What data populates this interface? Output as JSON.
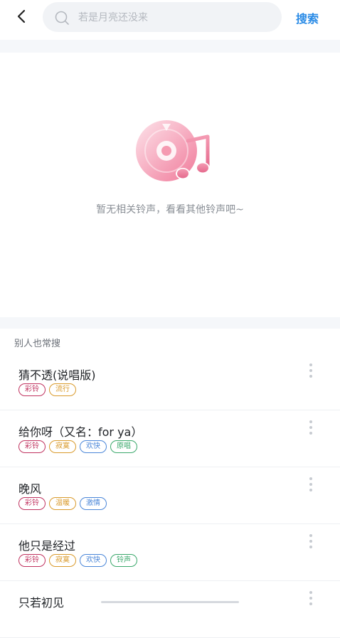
{
  "search": {
    "placeholder": "若是月亮还没来",
    "button_label": "搜索"
  },
  "empty_state": {
    "message": "暂无相关铃声，看看其他铃声吧~"
  },
  "suggestions": {
    "title": "别人也常搜",
    "items": [
      {
        "name": "猜不透(说唱版)",
        "tags": [
          {
            "label": "彩铃",
            "color": "#c0325f"
          },
          {
            "label": "流行",
            "color": "#d99a2b"
          }
        ]
      },
      {
        "name": "给你呀（又名：for ya）",
        "tags": [
          {
            "label": "彩铃",
            "color": "#c0325f"
          },
          {
            "label": "寂寞",
            "color": "#d99a2b"
          },
          {
            "label": "欢快",
            "color": "#4a86d8"
          },
          {
            "label": "原唱",
            "color": "#3aa86b"
          }
        ]
      },
      {
        "name": "晚风",
        "tags": [
          {
            "label": "彩铃",
            "color": "#c0325f"
          },
          {
            "label": "温暖",
            "color": "#d99a2b"
          },
          {
            "label": "激情",
            "color": "#4a86d8"
          }
        ]
      },
      {
        "name": "他只是经过",
        "tags": [
          {
            "label": "彩铃",
            "color": "#c0325f"
          },
          {
            "label": "寂寞",
            "color": "#d99a2b"
          },
          {
            "label": "欢快",
            "color": "#4a86d8"
          },
          {
            "label": "铃声",
            "color": "#3aa86b"
          }
        ]
      },
      {
        "name": "只若初见",
        "tags": []
      }
    ]
  },
  "icons": {
    "back": "chevron-left-icon",
    "search": "search-icon",
    "more": "more-vertical-icon",
    "empty": "music-disc-icon"
  },
  "colors": {
    "accent": "#2a8be6",
    "empty_pink": "#f08aa6"
  }
}
